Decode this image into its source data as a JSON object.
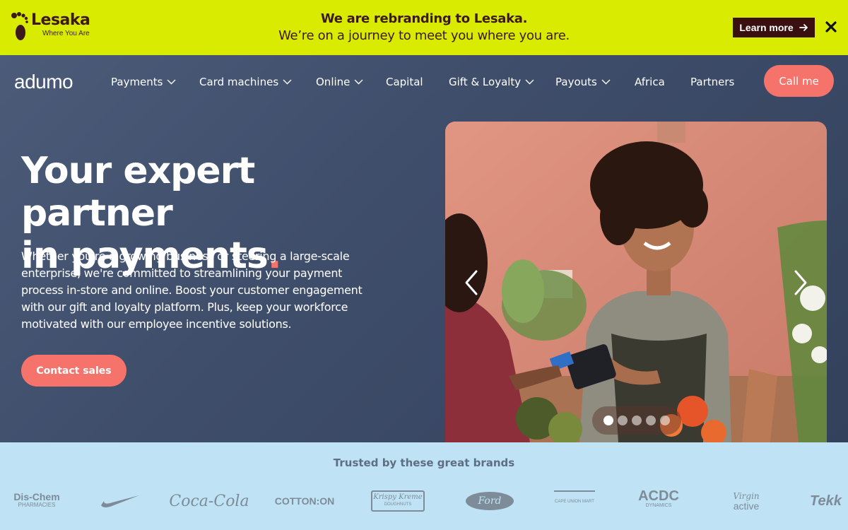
{
  "banner": {
    "logo_name": "Lesaka",
    "logo_tagline": "Where You Are",
    "title": "We are rebranding to Lesaka.",
    "subtitle": "We’re on a journey to meet you where you are.",
    "learn_more": "Learn more",
    "background": "#d9ec00",
    "close_icon": "close-icon"
  },
  "header": {
    "logo": "adumo",
    "nav": [
      {
        "label": "Payments",
        "dropdown": true
      },
      {
        "label": "Card machines",
        "dropdown": true
      },
      {
        "label": "Online",
        "dropdown": true
      },
      {
        "label": "Capital",
        "dropdown": false
      },
      {
        "label": "Gift & Loyalty",
        "dropdown": true
      },
      {
        "label": "Payouts",
        "dropdown": true
      },
      {
        "label": "Africa",
        "dropdown": false
      },
      {
        "label": "Partners",
        "dropdown": false
      }
    ],
    "call_me": "Call me",
    "accent": "#f5736a"
  },
  "hero": {
    "headline_line1": "Your expert partner",
    "headline_line2": "in payments",
    "headline_dot": ".",
    "description": "Whether you're a growing business or steering a large-scale enterprise, we're committed to streamlining your payment process in-store and online. Boost your customer engagement with our gift and loyalty platform. Plus, keep your workforce motivated with our employee incentive solutions.",
    "cta": "Contact sales",
    "carousel": {
      "slides": 5,
      "active_index": 1
    }
  },
  "brands": {
    "title": "Trusted by these great brands",
    "items": [
      {
        "name": "Dis-Chem",
        "sub": "PHARMACIES"
      },
      {
        "name": "Nike",
        "sub": ""
      },
      {
        "name": "Coca-Cola",
        "sub": ""
      },
      {
        "name": "COTTON:ON",
        "sub": ""
      },
      {
        "name": "Krispy Kreme",
        "sub": "DOUGHNUTS"
      },
      {
        "name": "Ford",
        "sub": ""
      },
      {
        "name": "CAPE UNION MART",
        "sub": ""
      },
      {
        "name": "ACDC",
        "sub": "DYNAMICS"
      },
      {
        "name": "Virgin",
        "sub": "active"
      },
      {
        "name": "Tekk",
        "sub": ""
      }
    ]
  }
}
